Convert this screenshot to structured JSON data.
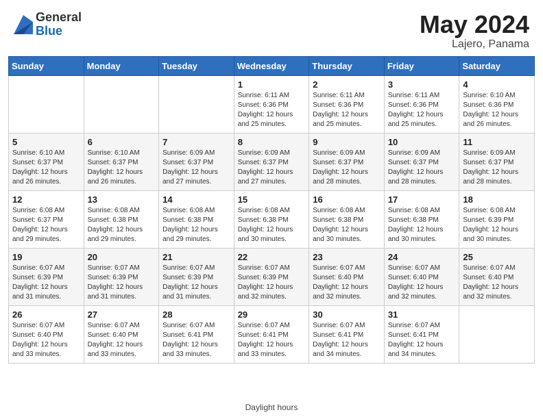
{
  "header": {
    "logo_general": "General",
    "logo_blue": "Blue",
    "title": "May 2024",
    "location": "Lajero, Panama"
  },
  "footer": {
    "label": "Daylight hours"
  },
  "days_of_week": [
    "Sunday",
    "Monday",
    "Tuesday",
    "Wednesday",
    "Thursday",
    "Friday",
    "Saturday"
  ],
  "weeks": [
    [
      {
        "day": "",
        "info": ""
      },
      {
        "day": "",
        "info": ""
      },
      {
        "day": "",
        "info": ""
      },
      {
        "day": "1",
        "info": "Sunrise: 6:11 AM\nSunset: 6:36 PM\nDaylight: 12 hours and 25 minutes."
      },
      {
        "day": "2",
        "info": "Sunrise: 6:11 AM\nSunset: 6:36 PM\nDaylight: 12 hours and 25 minutes."
      },
      {
        "day": "3",
        "info": "Sunrise: 6:11 AM\nSunset: 6:36 PM\nDaylight: 12 hours and 25 minutes."
      },
      {
        "day": "4",
        "info": "Sunrise: 6:10 AM\nSunset: 6:36 PM\nDaylight: 12 hours and 26 minutes."
      }
    ],
    [
      {
        "day": "5",
        "info": "Sunrise: 6:10 AM\nSunset: 6:37 PM\nDaylight: 12 hours and 26 minutes."
      },
      {
        "day": "6",
        "info": "Sunrise: 6:10 AM\nSunset: 6:37 PM\nDaylight: 12 hours and 26 minutes."
      },
      {
        "day": "7",
        "info": "Sunrise: 6:09 AM\nSunset: 6:37 PM\nDaylight: 12 hours and 27 minutes."
      },
      {
        "day": "8",
        "info": "Sunrise: 6:09 AM\nSunset: 6:37 PM\nDaylight: 12 hours and 27 minutes."
      },
      {
        "day": "9",
        "info": "Sunrise: 6:09 AM\nSunset: 6:37 PM\nDaylight: 12 hours and 28 minutes."
      },
      {
        "day": "10",
        "info": "Sunrise: 6:09 AM\nSunset: 6:37 PM\nDaylight: 12 hours and 28 minutes."
      },
      {
        "day": "11",
        "info": "Sunrise: 6:09 AM\nSunset: 6:37 PM\nDaylight: 12 hours and 28 minutes."
      }
    ],
    [
      {
        "day": "12",
        "info": "Sunrise: 6:08 AM\nSunset: 6:37 PM\nDaylight: 12 hours and 29 minutes."
      },
      {
        "day": "13",
        "info": "Sunrise: 6:08 AM\nSunset: 6:38 PM\nDaylight: 12 hours and 29 minutes."
      },
      {
        "day": "14",
        "info": "Sunrise: 6:08 AM\nSunset: 6:38 PM\nDaylight: 12 hours and 29 minutes."
      },
      {
        "day": "15",
        "info": "Sunrise: 6:08 AM\nSunset: 6:38 PM\nDaylight: 12 hours and 30 minutes."
      },
      {
        "day": "16",
        "info": "Sunrise: 6:08 AM\nSunset: 6:38 PM\nDaylight: 12 hours and 30 minutes."
      },
      {
        "day": "17",
        "info": "Sunrise: 6:08 AM\nSunset: 6:38 PM\nDaylight: 12 hours and 30 minutes."
      },
      {
        "day": "18",
        "info": "Sunrise: 6:08 AM\nSunset: 6:39 PM\nDaylight: 12 hours and 30 minutes."
      }
    ],
    [
      {
        "day": "19",
        "info": "Sunrise: 6:07 AM\nSunset: 6:39 PM\nDaylight: 12 hours and 31 minutes."
      },
      {
        "day": "20",
        "info": "Sunrise: 6:07 AM\nSunset: 6:39 PM\nDaylight: 12 hours and 31 minutes."
      },
      {
        "day": "21",
        "info": "Sunrise: 6:07 AM\nSunset: 6:39 PM\nDaylight: 12 hours and 31 minutes."
      },
      {
        "day": "22",
        "info": "Sunrise: 6:07 AM\nSunset: 6:39 PM\nDaylight: 12 hours and 32 minutes."
      },
      {
        "day": "23",
        "info": "Sunrise: 6:07 AM\nSunset: 6:40 PM\nDaylight: 12 hours and 32 minutes."
      },
      {
        "day": "24",
        "info": "Sunrise: 6:07 AM\nSunset: 6:40 PM\nDaylight: 12 hours and 32 minutes."
      },
      {
        "day": "25",
        "info": "Sunrise: 6:07 AM\nSunset: 6:40 PM\nDaylight: 12 hours and 32 minutes."
      }
    ],
    [
      {
        "day": "26",
        "info": "Sunrise: 6:07 AM\nSunset: 6:40 PM\nDaylight: 12 hours and 33 minutes."
      },
      {
        "day": "27",
        "info": "Sunrise: 6:07 AM\nSunset: 6:40 PM\nDaylight: 12 hours and 33 minutes."
      },
      {
        "day": "28",
        "info": "Sunrise: 6:07 AM\nSunset: 6:41 PM\nDaylight: 12 hours and 33 minutes."
      },
      {
        "day": "29",
        "info": "Sunrise: 6:07 AM\nSunset: 6:41 PM\nDaylight: 12 hours and 33 minutes."
      },
      {
        "day": "30",
        "info": "Sunrise: 6:07 AM\nSunset: 6:41 PM\nDaylight: 12 hours and 34 minutes."
      },
      {
        "day": "31",
        "info": "Sunrise: 6:07 AM\nSunset: 6:41 PM\nDaylight: 12 hours and 34 minutes."
      },
      {
        "day": "",
        "info": ""
      }
    ]
  ]
}
